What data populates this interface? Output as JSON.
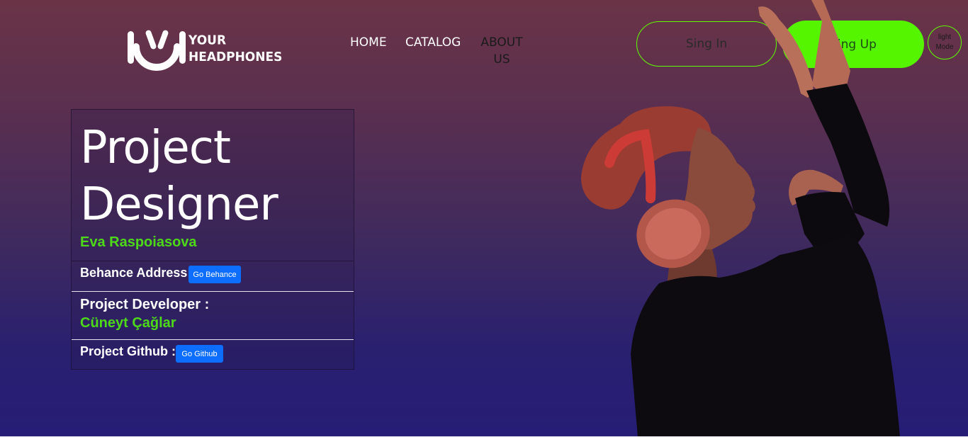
{
  "header": {
    "logo": {
      "line1": "YOUR",
      "line2": "HEADPHONES"
    },
    "nav": {
      "home": "HOME",
      "catalog": "CATALOG",
      "about_line1": "ABOUT",
      "about_line2": "US"
    },
    "sign_in_label": "Sing In",
    "sign_up_label": "Sing Up",
    "mode_line1": "light",
    "mode_line2": "Mode"
  },
  "card": {
    "title_line1": "Project",
    "title_line2": "Designer",
    "designer_name": "Eva Raspoiasova",
    "behance_label": "Behance Address:",
    "behance_button": "Go Behance",
    "developer_label": "Project Developer :",
    "developer_name": "Cüneyt Çağlar",
    "github_label": "Project Github :",
    "github_button": "Go Github"
  },
  "colors": {
    "accent_green": "#55f500",
    "name_green": "#4dd91a",
    "button_blue": "#0d6efd"
  },
  "hero_image": "woman-wearing-headphones-dancing"
}
